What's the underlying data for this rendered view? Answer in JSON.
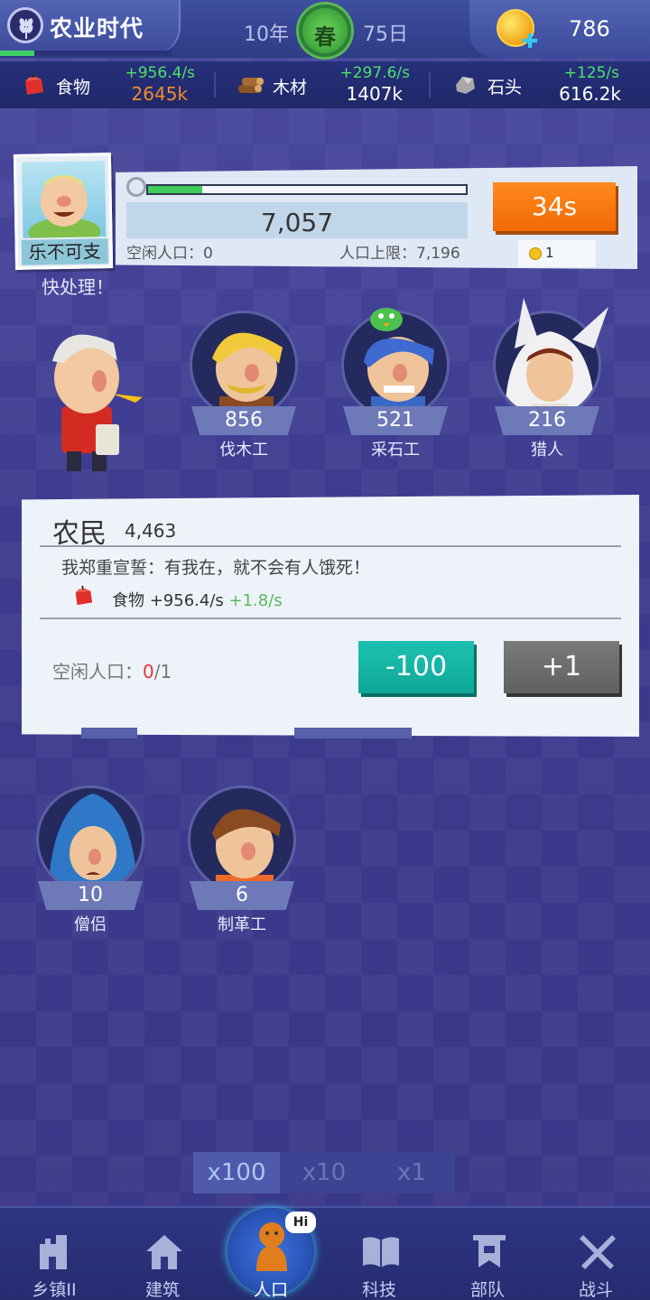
{
  "header": {
    "era_title": "农业时代",
    "era_progress": 0.2,
    "year": "10年",
    "season": "春",
    "day": "75日",
    "coins": "786"
  },
  "resources": [
    {
      "name": "食物",
      "rate": "+956.4/s",
      "amount": "2645k",
      "amount_color": "#f28a2e",
      "icon": "apple-icon"
    },
    {
      "name": "木材",
      "rate": "+297.6/s",
      "amount": "1407k",
      "amount_color": "#ffffff",
      "icon": "wood-log-icon"
    },
    {
      "name": "石头",
      "rate": "+125/s",
      "amount": "616.2k",
      "amount_color": "#ffffff",
      "icon": "stone-icon"
    }
  ],
  "population": {
    "leader_name": "乐不可支",
    "growth_progress": 0.17,
    "total": "7,057",
    "idle_label": "空闲人口：0",
    "limit_label": "人口上限：7,196",
    "timer": "34s",
    "cost": "1",
    "notice": "快处理！"
  },
  "workers_row1": [
    {
      "name": "",
      "count": ""
    },
    {
      "name": "伐木工",
      "count": "856"
    },
    {
      "name": "采石工",
      "count": "521"
    },
    {
      "name": "猎人",
      "count": "216"
    }
  ],
  "detail": {
    "title": "农民",
    "count": "4,463",
    "quote": "我郑重宣誓：有我在，就不会有人饿死！",
    "resource_label": "食物 +956.4/s",
    "resource_bonus": "+1.8/s",
    "idle_label": "空闲人口：",
    "idle_current": "0",
    "idle_total": "/1",
    "minus_label": "-100",
    "plus_label": "+1"
  },
  "workers_row2": [
    {
      "name": "僧侣",
      "count": "10"
    },
    {
      "name": "制革工",
      "count": "6"
    }
  ],
  "multiplier": {
    "options": [
      "x100",
      "x10",
      "x1"
    ],
    "selected": "x100"
  },
  "nav": [
    {
      "label": "乡镇II",
      "icon": "castle-icon"
    },
    {
      "label": "建筑",
      "icon": "house-icon"
    },
    {
      "label": "人口",
      "icon": "villager-icon",
      "badge": "Hi"
    },
    {
      "label": "科技",
      "icon": "book-icon"
    },
    {
      "label": "部队",
      "icon": "banner-icon"
    },
    {
      "label": "战斗",
      "icon": "crossed-swords-icon"
    }
  ],
  "colors": {
    "background": "#3c3a8e",
    "accent_green": "#4ee06b",
    "timer_orange": "#f57a10",
    "teal_button": "#17b5a5",
    "gray_button": "#6e6e6e"
  }
}
